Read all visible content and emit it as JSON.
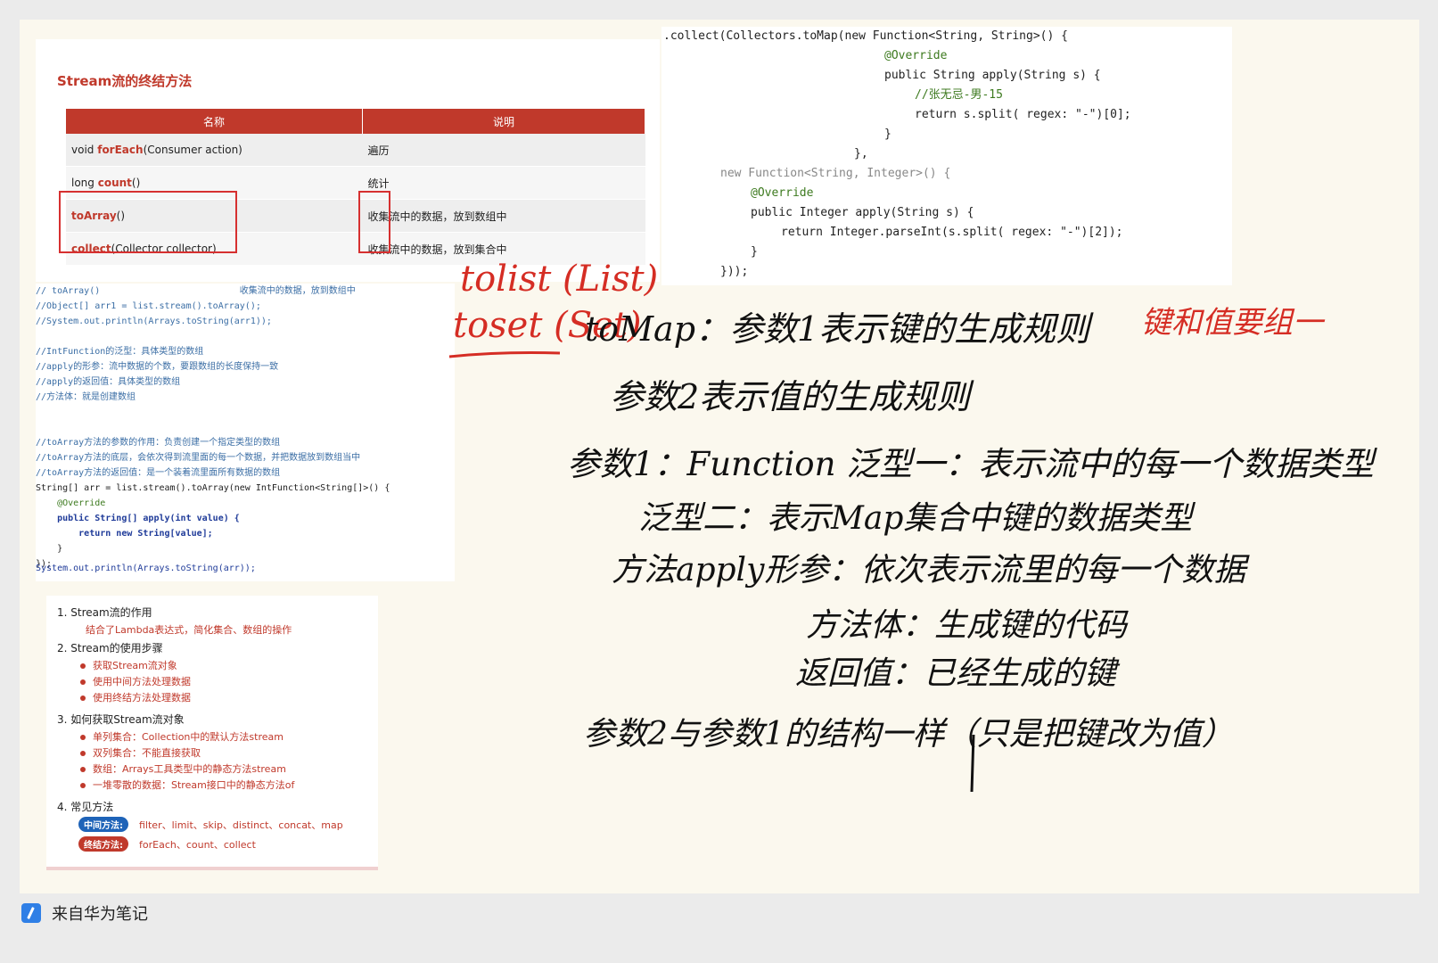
{
  "slide": {
    "title": "Stream流的终结方法",
    "table": {
      "headers": [
        "名称",
        "说明"
      ],
      "rows": [
        {
          "prefix": "void ",
          "method": "forEach",
          "suffix": "(Consumer action)",
          "desc": "遍历"
        },
        {
          "prefix": "long ",
          "method": "count",
          "suffix": "()",
          "desc": "统计"
        },
        {
          "prefix": "",
          "method": "toArray",
          "suffix": "()",
          "desc": "收集流中的数据，放到数组中"
        },
        {
          "prefix": "",
          "method": "collect",
          "suffix": "(Collector collector)",
          "desc": "收集流中的数据，放到集合中"
        }
      ]
    }
  },
  "code_top": [
    ".collect(Collectors.toMap(new Function<String, String>() {",
    "@Override",
    "public String apply(String s) {",
    "//张无忌-男-15",
    "return s.split( regex: \"-\")[0];",
    "}",
    "},",
    "new Function<String, Integer>() {",
    "@Override",
    "public Integer apply(String s) {",
    "return Integer.parseInt(s.split( regex: \"-\")[2]);",
    "}",
    "}));"
  ],
  "code_mid": [
    "// toArray()                          收集流中的数据，放到数组中",
    "//Object[] arr1 = list.stream().toArray();",
    "//System.out.println(Arrays.toString(arr1));",
    "",
    "//IntFunction的泛型：具体类型的数组",
    "//apply的形参：流中数据的个数，要跟数组的长度保持一致",
    "//apply的返回值：具体类型的数组",
    "//方法体：就是创建数组",
    "",
    "",
    "//toArray方法的参数的作用：负责创建一个指定类型的数组",
    "//toArray方法的底层，会依次得到流里面的每一个数据，并把数据放到数组当中",
    "//toArray方法的返回值：是一个装着流里面所有数据的数组",
    "String[] arr = list.stream().toArray(new IntFunction<String[]>() {",
    "    @Override",
    "    public String[] apply(int value) {",
    "        return new String[value];",
    "    }",
    "});"
  ],
  "code_sysout": "System.out.println(Arrays.toString(arr));",
  "summary": {
    "items": [
      {
        "title": "1. Stream流的作用",
        "subs": [
          "结合了Lambda表达式，简化集合、数组的操作"
        ],
        "bullets": false
      },
      {
        "title": "2. Stream的使用步骤",
        "subs": [
          "获取Stream流对象",
          "使用中间方法处理数据",
          "使用终结方法处理数据"
        ],
        "bullets": true
      },
      {
        "title": "3. 如何获取Stream流对象",
        "subs": [
          "单列集合：Collection中的默认方法stream",
          "双列集合：不能直接获取",
          "数组：Arrays工具类型中的静态方法stream",
          "一堆零散的数据：Stream接口中的静态方法of"
        ],
        "bullets": true
      },
      {
        "title": "4. 常见方法",
        "subs": [],
        "bullets": false
      }
    ],
    "pills": [
      {
        "label": "中间方法:",
        "text": "filter、limit、skip、distinct、concat、map"
      },
      {
        "label": "终结方法:",
        "text": "forEach、count、collect"
      }
    ]
  },
  "handwriting": {
    "red": [
      "tolist (List)",
      "toset (Set)",
      "键和值要组一"
    ],
    "black": [
      "toMap：参数1表示键的生成规则",
      "参数2表示值的生成规则",
      "参数1：Function 泛型一：表示流中的每一个数据类型",
      "泛型二：表示Map集合中键的数据类型",
      "方法apply形参：依次表示流里的每一个数据",
      "方法体：生成键的代码",
      "返回值：已经生成的键",
      "参数2与参数1的结构一样（只是把键改为值）"
    ]
  },
  "footer": {
    "text": "来自华为笔记",
    "icon": "notes-pen-icon"
  }
}
